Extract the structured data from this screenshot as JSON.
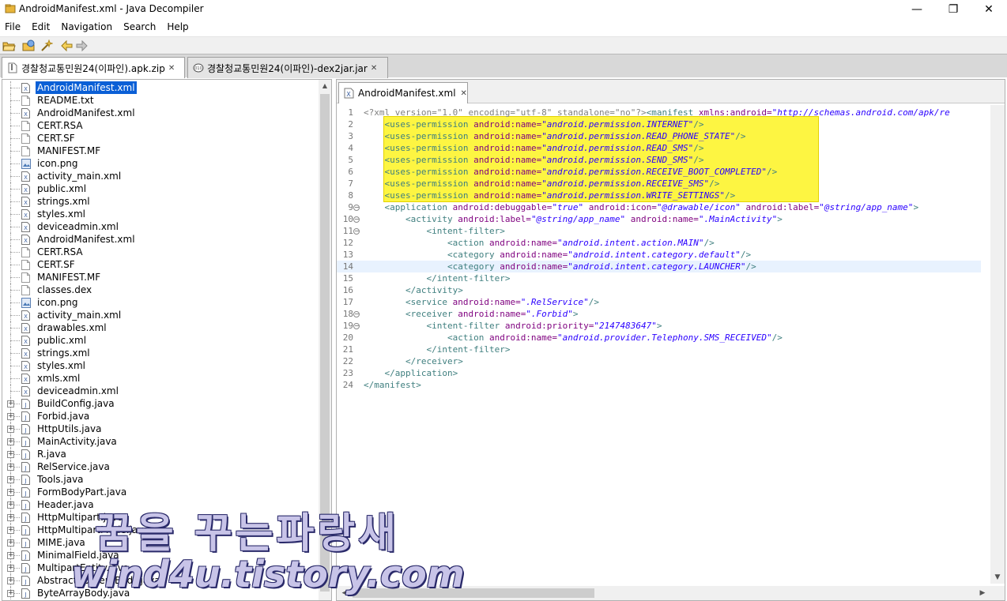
{
  "window": {
    "title": "AndroidManifest.xml - Java Decompiler",
    "minimize_glyph": "—",
    "maximize_glyph": "❐",
    "close_glyph": "✕"
  },
  "menu": [
    "File",
    "Edit",
    "Navigation",
    "Search",
    "Help"
  ],
  "toolbar": {
    "icons": [
      "open-file-icon",
      "open-type-icon",
      "settings-wand-icon",
      "back-icon",
      "forward-icon"
    ]
  },
  "file_tabs": [
    {
      "label": "경찰청교통민원24(이파인).apk.zip",
      "icon": "zip-archive-icon",
      "active": true
    },
    {
      "label": "경찰청교통민원24(이파인)-dex2jar.jar",
      "icon": "jar-archive-icon",
      "active": false
    }
  ],
  "tree": [
    {
      "name": "AndroidManifest.xml",
      "type": "xml",
      "selected": true
    },
    {
      "name": "README.txt",
      "type": "file"
    },
    {
      "name": "AndroidManifest.xml",
      "type": "xml"
    },
    {
      "name": "CERT.RSA",
      "type": "file"
    },
    {
      "name": "CERT.SF",
      "type": "file"
    },
    {
      "name": "MANIFEST.MF",
      "type": "file"
    },
    {
      "name": "icon.png",
      "type": "image"
    },
    {
      "name": "activity_main.xml",
      "type": "xml"
    },
    {
      "name": "public.xml",
      "type": "xml"
    },
    {
      "name": "strings.xml",
      "type": "xml"
    },
    {
      "name": "styles.xml",
      "type": "xml"
    },
    {
      "name": "deviceadmin.xml",
      "type": "xml"
    },
    {
      "name": "AndroidManifest.xml",
      "type": "xml"
    },
    {
      "name": "CERT.RSA",
      "type": "file"
    },
    {
      "name": "CERT.SF",
      "type": "file"
    },
    {
      "name": "MANIFEST.MF",
      "type": "file"
    },
    {
      "name": "classes.dex",
      "type": "file"
    },
    {
      "name": "icon.png",
      "type": "image"
    },
    {
      "name": "activity_main.xml",
      "type": "xml"
    },
    {
      "name": "drawables.xml",
      "type": "xml"
    },
    {
      "name": "public.xml",
      "type": "xml"
    },
    {
      "name": "strings.xml",
      "type": "xml"
    },
    {
      "name": "styles.xml",
      "type": "xml"
    },
    {
      "name": "xmls.xml",
      "type": "xml"
    },
    {
      "name": "deviceadmin.xml",
      "type": "xml"
    },
    {
      "name": "BuildConfig.java",
      "type": "java"
    },
    {
      "name": "Forbid.java",
      "type": "java"
    },
    {
      "name": "HttpUtils.java",
      "type": "java"
    },
    {
      "name": "MainActivity.java",
      "type": "java"
    },
    {
      "name": "R.java",
      "type": "java"
    },
    {
      "name": "RelService.java",
      "type": "java"
    },
    {
      "name": "Tools.java",
      "type": "java"
    },
    {
      "name": "FormBodyPart.java",
      "type": "java"
    },
    {
      "name": "Header.java",
      "type": "java"
    },
    {
      "name": "HttpMultipart.java",
      "type": "java"
    },
    {
      "name": "HttpMultipartMode.java",
      "type": "java"
    },
    {
      "name": "MIME.java",
      "type": "java"
    },
    {
      "name": "MinimalField.java",
      "type": "java"
    },
    {
      "name": "MultipartEntity.java",
      "type": "java"
    },
    {
      "name": "AbstractContentBody.java",
      "type": "java"
    },
    {
      "name": "ByteArrayBody.java",
      "type": "java"
    }
  ],
  "editor_tab": {
    "label": "AndroidManifest.xml",
    "close_glyph": "✕"
  },
  "editor_lines": [
    {
      "n": "1",
      "fold": false,
      "indent": "",
      "parts": [
        [
          "pi",
          "<?xml version=\"1.0\" encoding=\"utf-8\" standalone=\"no\"?>"
        ],
        [
          "tag",
          "<manifest "
        ],
        [
          "attr",
          "xmlns:android="
        ],
        [
          "val",
          "\"http://schemas.android.com/apk/re"
        ]
      ]
    },
    {
      "n": "2",
      "fold": false,
      "indent": "    ",
      "parts": [
        [
          "tag",
          "<uses-permission "
        ],
        [
          "attr",
          "android:name="
        ],
        [
          "val",
          "\"android.permission.INTERNET\""
        ],
        [
          "tag",
          "/>"
        ]
      ]
    },
    {
      "n": "3",
      "fold": false,
      "indent": "    ",
      "parts": [
        [
          "tag",
          "<uses-permission "
        ],
        [
          "attr",
          "android:name="
        ],
        [
          "val",
          "\"android.permission.READ_PHONE_STATE\""
        ],
        [
          "tag",
          "/>"
        ]
      ]
    },
    {
      "n": "4",
      "fold": false,
      "indent": "    ",
      "parts": [
        [
          "tag",
          "<uses-permission "
        ],
        [
          "attr",
          "android:name="
        ],
        [
          "val",
          "\"android.permission.READ_SMS\""
        ],
        [
          "tag",
          "/>"
        ]
      ]
    },
    {
      "n": "5",
      "fold": false,
      "indent": "    ",
      "parts": [
        [
          "tag",
          "<uses-permission "
        ],
        [
          "attr",
          "android:name="
        ],
        [
          "val",
          "\"android.permission.SEND_SMS\""
        ],
        [
          "tag",
          "/>"
        ]
      ]
    },
    {
      "n": "6",
      "fold": false,
      "indent": "    ",
      "parts": [
        [
          "tag",
          "<uses-permission "
        ],
        [
          "attr",
          "android:name="
        ],
        [
          "val",
          "\"android.permission.RECEIVE_BOOT_COMPLETED\""
        ],
        [
          "tag",
          "/>"
        ]
      ]
    },
    {
      "n": "7",
      "fold": false,
      "indent": "    ",
      "parts": [
        [
          "tag",
          "<uses-permission "
        ],
        [
          "attr",
          "android:name="
        ],
        [
          "val",
          "\"android.permission.RECEIVE_SMS\""
        ],
        [
          "tag",
          "/>"
        ]
      ]
    },
    {
      "n": "8",
      "fold": false,
      "indent": "    ",
      "parts": [
        [
          "tag",
          "<uses-permission "
        ],
        [
          "attr",
          "android:name="
        ],
        [
          "val",
          "\"android.permission.WRITE_SETTINGS\""
        ],
        [
          "tag",
          "/>"
        ]
      ]
    },
    {
      "n": "9",
      "fold": true,
      "indent": "    ",
      "parts": [
        [
          "tag",
          "<application "
        ],
        [
          "attr",
          "android:debuggable="
        ],
        [
          "val",
          "\"true\""
        ],
        [
          "attr",
          " android:icon="
        ],
        [
          "val",
          "\"@drawable/icon\""
        ],
        [
          "attr",
          " android:label="
        ],
        [
          "val",
          "\"@string/app_name\""
        ],
        [
          "tag",
          ">"
        ]
      ]
    },
    {
      "n": "10",
      "fold": true,
      "indent": "        ",
      "parts": [
        [
          "tag",
          "<activity "
        ],
        [
          "attr",
          "android:label="
        ],
        [
          "val",
          "\"@string/app_name\""
        ],
        [
          "attr",
          " android:name="
        ],
        [
          "val",
          "\".MainActivity\""
        ],
        [
          "tag",
          ">"
        ]
      ]
    },
    {
      "n": "11",
      "fold": true,
      "indent": "            ",
      "parts": [
        [
          "tag",
          "<intent-filter>"
        ]
      ]
    },
    {
      "n": "12",
      "fold": false,
      "indent": "                ",
      "parts": [
        [
          "tag",
          "<action "
        ],
        [
          "attr",
          "android:name="
        ],
        [
          "val",
          "\"android.intent.action.MAIN\""
        ],
        [
          "tag",
          "/>"
        ]
      ]
    },
    {
      "n": "13",
      "fold": false,
      "indent": "                ",
      "parts": [
        [
          "tag",
          "<category "
        ],
        [
          "attr",
          "android:name="
        ],
        [
          "val",
          "\"android.intent.category.default\""
        ],
        [
          "tag",
          "/>"
        ]
      ]
    },
    {
      "n": "14",
      "fold": false,
      "indent": "                ",
      "current": true,
      "parts": [
        [
          "tag",
          "<category "
        ],
        [
          "attr",
          "android:name="
        ],
        [
          "val",
          "\"android.intent.category.LAUNCHER\""
        ],
        [
          "tag",
          "/>"
        ]
      ]
    },
    {
      "n": "15",
      "fold": false,
      "indent": "            ",
      "parts": [
        [
          "tag",
          "</intent-filter>"
        ]
      ]
    },
    {
      "n": "16",
      "fold": false,
      "indent": "        ",
      "parts": [
        [
          "tag",
          "</activity>"
        ]
      ]
    },
    {
      "n": "17",
      "fold": false,
      "indent": "        ",
      "parts": [
        [
          "tag",
          "<service "
        ],
        [
          "attr",
          "android:name="
        ],
        [
          "val",
          "\".RelService\""
        ],
        [
          "tag",
          "/>"
        ]
      ]
    },
    {
      "n": "18",
      "fold": true,
      "indent": "        ",
      "parts": [
        [
          "tag",
          "<receiver "
        ],
        [
          "attr",
          "android:name="
        ],
        [
          "val",
          "\".Forbid\""
        ],
        [
          "tag",
          ">"
        ]
      ]
    },
    {
      "n": "19",
      "fold": true,
      "indent": "            ",
      "parts": [
        [
          "tag",
          "<intent-filter "
        ],
        [
          "attr",
          "android:priority="
        ],
        [
          "val",
          "\"2147483647\""
        ],
        [
          "tag",
          ">"
        ]
      ]
    },
    {
      "n": "20",
      "fold": false,
      "indent": "                ",
      "parts": [
        [
          "tag",
          "<action "
        ],
        [
          "attr",
          "android:name="
        ],
        [
          "val",
          "\"android.provider.Telephony.SMS_RECEIVED\""
        ],
        [
          "tag",
          "/>"
        ]
      ]
    },
    {
      "n": "21",
      "fold": false,
      "indent": "            ",
      "parts": [
        [
          "tag",
          "</intent-filter>"
        ]
      ]
    },
    {
      "n": "22",
      "fold": false,
      "indent": "        ",
      "parts": [
        [
          "tag",
          "</receiver>"
        ]
      ]
    },
    {
      "n": "23",
      "fold": false,
      "indent": "    ",
      "parts": [
        [
          "tag",
          "</application>"
        ]
      ]
    },
    {
      "n": "24",
      "fold": false,
      "indent": "",
      "parts": [
        [
          "tag",
          "</manifest>"
        ]
      ]
    }
  ],
  "watermark": {
    "line1": "꿈을 꾸는파랑새",
    "line2": "wind4u.tistory.com"
  },
  "colors": {
    "selection": "#0a5fd6",
    "highlight": "#fdf542",
    "xml_tag": "#3f7f7f",
    "xml_attr": "#7f007f",
    "xml_value": "#2a00ff"
  }
}
